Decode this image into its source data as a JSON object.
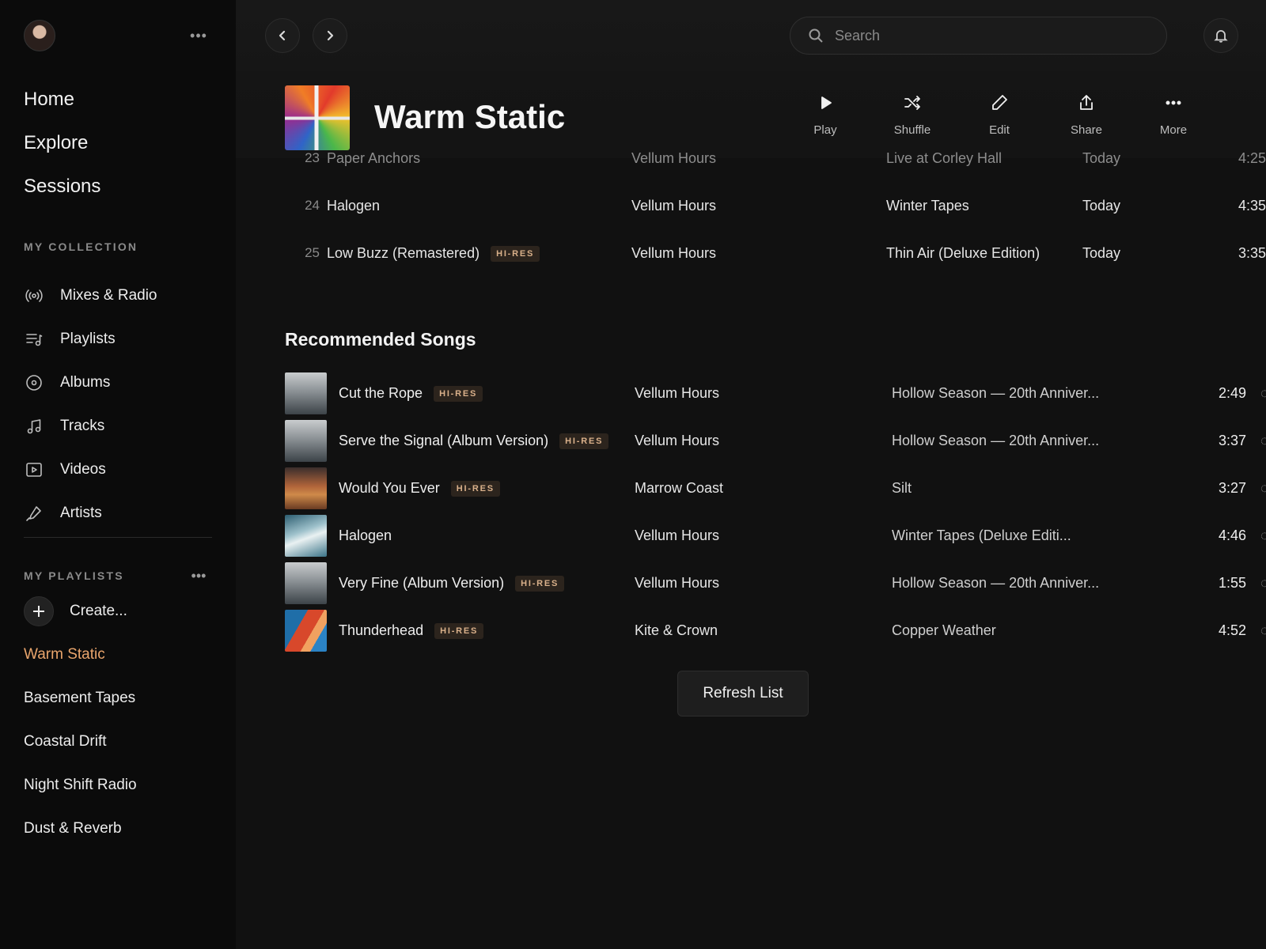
{
  "sidebar": {
    "main_nav": [
      "Home",
      "Explore",
      "Sessions"
    ],
    "collection_label": "MY COLLECTION",
    "collection": [
      {
        "label": "Mixes & Radio",
        "icon": "radio-icon"
      },
      {
        "label": "Playlists",
        "icon": "playlist-icon"
      },
      {
        "label": "Albums",
        "icon": "album-icon"
      },
      {
        "label": "Tracks",
        "icon": "music-note-icon"
      },
      {
        "label": "Videos",
        "icon": "video-icon"
      },
      {
        "label": "Artists",
        "icon": "microphone-icon"
      }
    ],
    "playlists_label": "MY PLAYLISTS",
    "create_label": "Create...",
    "playlists": [
      "Warm Static",
      "Basement Tapes",
      "Coastal Drift",
      "Night Shift Radio",
      "Dust & Reverb"
    ],
    "active_playlist": "Warm Static"
  },
  "search": {
    "placeholder": "Search"
  },
  "header": {
    "title": "Warm Static",
    "actions": [
      "Play",
      "Shuffle",
      "Edit",
      "Share",
      "More"
    ]
  },
  "tracks": [
    {
      "num": "23",
      "title": "Paper Anchors",
      "artist": "Vellum Hours",
      "album": "Live at Corley Hall",
      "added": "Today",
      "duration": "4:25",
      "hires": false
    },
    {
      "num": "24",
      "title": "Halogen",
      "artist": "Vellum Hours",
      "album": "Winter Tapes",
      "added": "Today",
      "duration": "4:35",
      "hires": false
    },
    {
      "num": "25",
      "title": "Low Buzz (Remastered)",
      "artist": "Vellum Hours",
      "album": "Thin Air (Deluxe Edition)",
      "added": "Today",
      "duration": "3:35",
      "hires": true
    }
  ],
  "badge_label": "HI-RES",
  "recommended": {
    "heading": "Recommended Songs",
    "songs": [
      {
        "title": "Cut the Rope",
        "artist": "Vellum Hours",
        "album": "Hollow Season — 20th Anniver...",
        "duration": "2:49",
        "hires": true
      },
      {
        "title": "Serve the Signal (Album Version)",
        "artist": "Vellum Hours",
        "album": "Hollow Season — 20th Anniver...",
        "duration": "3:37",
        "hires": true
      },
      {
        "title": "Would You Ever",
        "artist": "Marrow Coast",
        "album": "Silt",
        "duration": "3:27",
        "hires": true
      },
      {
        "title": "Halogen",
        "artist": "Vellum Hours",
        "album": "Winter Tapes (Deluxe Editi...",
        "duration": "4:46",
        "hires": false
      },
      {
        "title": "Very Fine (Album Version)",
        "artist": "Vellum Hours",
        "album": "Hollow Season — 20th Anniver...",
        "duration": "1:55",
        "hires": true
      },
      {
        "title": "Thunderhead",
        "artist": "Kite & Crown",
        "album": "Copper Weather",
        "duration": "4:52",
        "hires": true
      }
    ],
    "refresh_label": "Refresh List"
  },
  "colors": {
    "accent": "#e9a56c",
    "background": "#111111",
    "sidebar": "#0b0b0b",
    "badge_text": "#d9b08a"
  }
}
